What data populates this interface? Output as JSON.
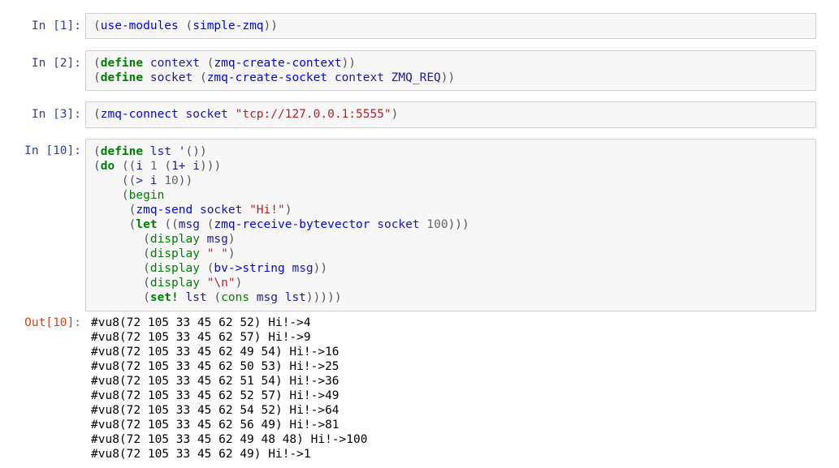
{
  "cells": [
    {
      "prompt": "In [1]:",
      "lines": [
        [
          [
            "par",
            "("
          ],
          [
            "fn",
            "use-modules"
          ],
          [
            "nm",
            " "
          ],
          [
            "par",
            "("
          ],
          [
            "fn",
            "simple-zmq"
          ],
          [
            "par",
            "))"
          ]
        ]
      ]
    },
    {
      "prompt": "In [2]:",
      "lines": [
        [
          [
            "par",
            "("
          ],
          [
            "kw",
            "define"
          ],
          [
            "nm",
            " context "
          ],
          [
            "par",
            "("
          ],
          [
            "fn",
            "zmq-create-context"
          ],
          [
            "par",
            "))"
          ]
        ],
        [
          [
            "par",
            "("
          ],
          [
            "kw",
            "define"
          ],
          [
            "nm",
            " socket "
          ],
          [
            "par",
            "("
          ],
          [
            "fn",
            "zmq-create-socket"
          ],
          [
            "nm",
            " context ZMQ_REQ"
          ],
          [
            "par",
            "))"
          ]
        ]
      ]
    },
    {
      "prompt": "In [3]:",
      "lines": [
        [
          [
            "par",
            "("
          ],
          [
            "fn",
            "zmq-connect"
          ],
          [
            "nm",
            " socket "
          ],
          [
            "str",
            "\"tcp://127.0.0.1:5555\""
          ],
          [
            "par",
            ")"
          ]
        ]
      ]
    },
    {
      "prompt": "In [10]:",
      "lines": [
        [
          [
            "par",
            "("
          ],
          [
            "kw",
            "define"
          ],
          [
            "nm",
            " lst "
          ],
          [
            "nm",
            "'"
          ],
          [
            "par",
            "())"
          ]
        ],
        [
          [
            "par",
            "("
          ],
          [
            "kw",
            "do"
          ],
          [
            "nm",
            " "
          ],
          [
            "par",
            "(("
          ],
          [
            "nm",
            "i "
          ],
          [
            "num",
            "1"
          ],
          [
            "nm",
            " "
          ],
          [
            "par",
            "("
          ],
          [
            "nm",
            "1+ i"
          ],
          [
            "par",
            ")))"
          ]
        ],
        [
          [
            "nm",
            "    "
          ],
          [
            "par",
            "(("
          ],
          [
            "nm",
            "> i "
          ],
          [
            "num",
            "10"
          ],
          [
            "par",
            "))"
          ]
        ],
        [
          [
            "nm",
            "    "
          ],
          [
            "par",
            "("
          ],
          [
            "bi",
            "begin"
          ]
        ],
        [
          [
            "nm",
            "     "
          ],
          [
            "par",
            "("
          ],
          [
            "fn",
            "zmq-send"
          ],
          [
            "nm",
            " socket "
          ],
          [
            "str",
            "\"Hi!\""
          ],
          [
            "par",
            ")"
          ]
        ],
        [
          [
            "nm",
            "     "
          ],
          [
            "par",
            "("
          ],
          [
            "kw",
            "let"
          ],
          [
            "nm",
            " "
          ],
          [
            "par",
            "(("
          ],
          [
            "nm",
            "msg "
          ],
          [
            "par",
            "("
          ],
          [
            "fn",
            "zmq-receive-bytevector"
          ],
          [
            "nm",
            " socket "
          ],
          [
            "num",
            "100"
          ],
          [
            "par",
            ")))"
          ]
        ],
        [
          [
            "nm",
            "       "
          ],
          [
            "par",
            "("
          ],
          [
            "bi",
            "display"
          ],
          [
            "nm",
            " msg"
          ],
          [
            "par",
            ")"
          ]
        ],
        [
          [
            "nm",
            "       "
          ],
          [
            "par",
            "("
          ],
          [
            "bi",
            "display"
          ],
          [
            "nm",
            " "
          ],
          [
            "str",
            "\" \""
          ],
          [
            "par",
            ")"
          ]
        ],
        [
          [
            "nm",
            "       "
          ],
          [
            "par",
            "("
          ],
          [
            "bi",
            "display"
          ],
          [
            "nm",
            " "
          ],
          [
            "par",
            "("
          ],
          [
            "fn",
            "bv->string"
          ],
          [
            "nm",
            " msg"
          ],
          [
            "par",
            "))"
          ]
        ],
        [
          [
            "nm",
            "       "
          ],
          [
            "par",
            "("
          ],
          [
            "bi",
            "display"
          ],
          [
            "nm",
            " "
          ],
          [
            "str",
            "\"\\n\""
          ],
          [
            "par",
            ")"
          ]
        ],
        [
          [
            "nm",
            "       "
          ],
          [
            "par",
            "("
          ],
          [
            "kw",
            "set!"
          ],
          [
            "nm",
            " lst "
          ],
          [
            "par",
            "("
          ],
          [
            "bi",
            "cons"
          ],
          [
            "nm",
            " msg lst"
          ],
          [
            "par",
            ")))))"
          ]
        ]
      ]
    }
  ],
  "output": {
    "prompt": "Out[10]:",
    "lines": [
      "#vu8(72 105 33 45 62 52) Hi!->4",
      "#vu8(72 105 33 45 62 57) Hi!->9",
      "#vu8(72 105 33 45 62 49 54) Hi!->16",
      "#vu8(72 105 33 45 62 50 53) Hi!->25",
      "#vu8(72 105 33 45 62 51 54) Hi!->36",
      "#vu8(72 105 33 45 62 52 57) Hi!->49",
      "#vu8(72 105 33 45 62 54 52) Hi!->64",
      "#vu8(72 105 33 45 62 56 49) Hi!->81",
      "#vu8(72 105 33 45 62 49 48 48) Hi!->100",
      "#vu8(72 105 33 45 62 49) Hi!->1"
    ]
  }
}
